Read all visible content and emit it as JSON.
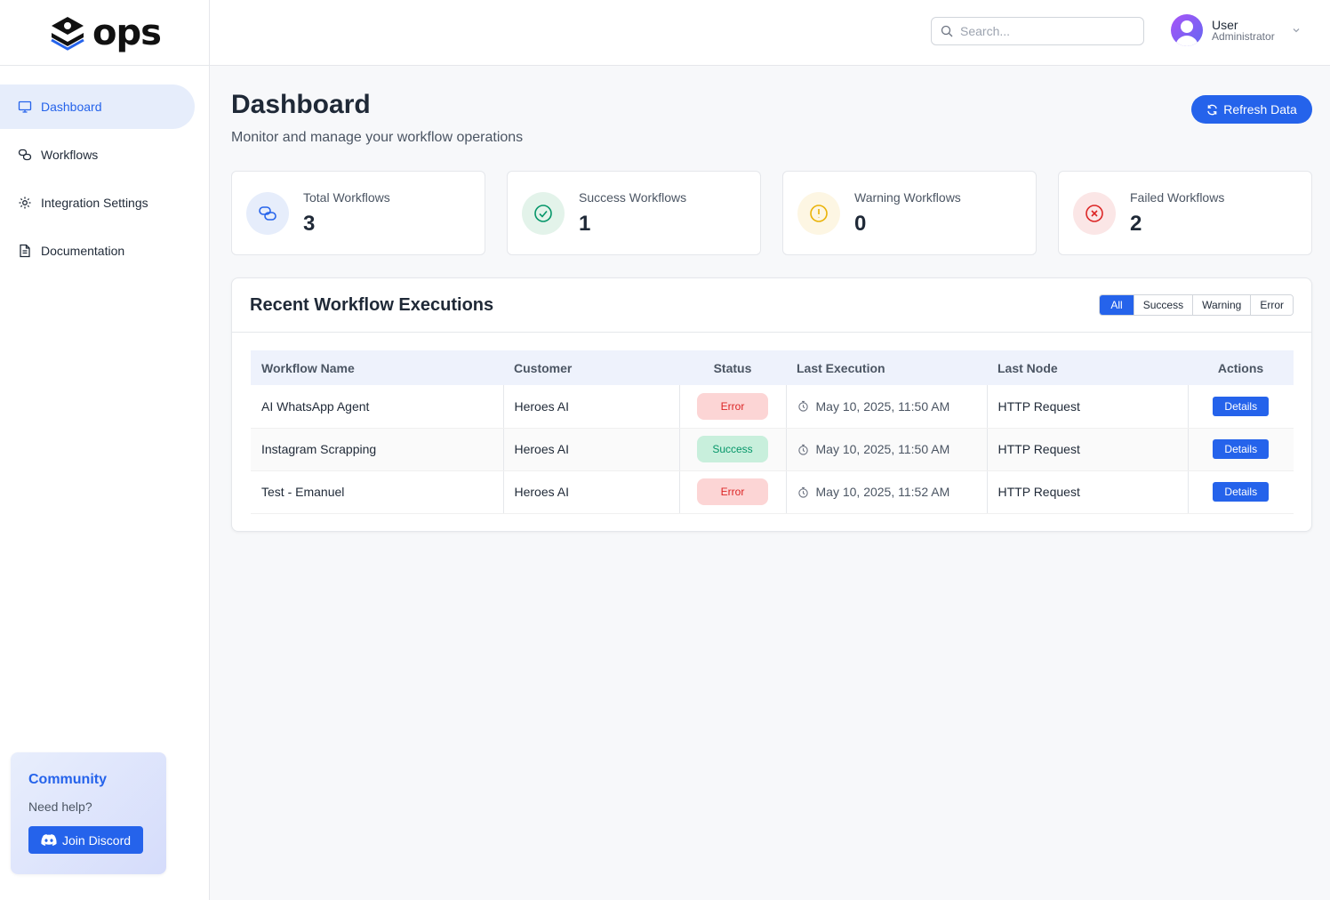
{
  "brand": {
    "name": "ops"
  },
  "sidebar": {
    "items": [
      {
        "label": "Dashboard",
        "icon": "monitor-icon",
        "active": true
      },
      {
        "label": "Workflows",
        "icon": "workflow-icon",
        "active": false
      },
      {
        "label": "Integration Settings",
        "icon": "gear-icon",
        "active": false
      },
      {
        "label": "Documentation",
        "icon": "document-icon",
        "active": false
      }
    ],
    "community": {
      "title": "Community",
      "subtitle": "Need help?",
      "button": "Join Discord"
    }
  },
  "header": {
    "search_placeholder": "Search...",
    "user": {
      "name": "User",
      "role": "Administrator"
    }
  },
  "main": {
    "title": "Dashboard",
    "subtitle": "Monitor and manage your workflow operations",
    "refresh_label": "Refresh Data",
    "stats": [
      {
        "label": "Total Workflows",
        "value": "3",
        "color": "#2563eb"
      },
      {
        "label": "Success Workflows",
        "value": "1",
        "color": "#059669"
      },
      {
        "label": "Warning Workflows",
        "value": "0",
        "color": "#eab308"
      },
      {
        "label": "Failed Workflows",
        "value": "2",
        "color": "#dc2626"
      }
    ],
    "panel": {
      "title": "Recent Workflow Executions",
      "filters": [
        "All",
        "Success",
        "Warning",
        "Error"
      ],
      "active_filter": "All",
      "columns": [
        "Workflow Name",
        "Customer",
        "Status",
        "Last Execution",
        "Last Node",
        "Actions"
      ],
      "rows": [
        {
          "name": "AI WhatsApp Agent",
          "customer": "Heroes AI",
          "status": "Error",
          "last_execution": "May 10, 2025, 11:50 AM",
          "last_node": "HTTP Request",
          "action": "Details"
        },
        {
          "name": "Instagram Scrapping",
          "customer": "Heroes AI",
          "status": "Success",
          "last_execution": "May 10, 2025, 11:50 AM",
          "last_node": "HTTP Request",
          "action": "Details"
        },
        {
          "name": "Test - Emanuel",
          "customer": "Heroes AI",
          "status": "Error",
          "last_execution": "May 10, 2025, 11:52 AM",
          "last_node": "HTTP Request",
          "action": "Details"
        }
      ]
    }
  },
  "colors": {
    "accent": "#2563eb",
    "error": "#dc2626",
    "success": "#059669",
    "warning": "#eab308"
  }
}
